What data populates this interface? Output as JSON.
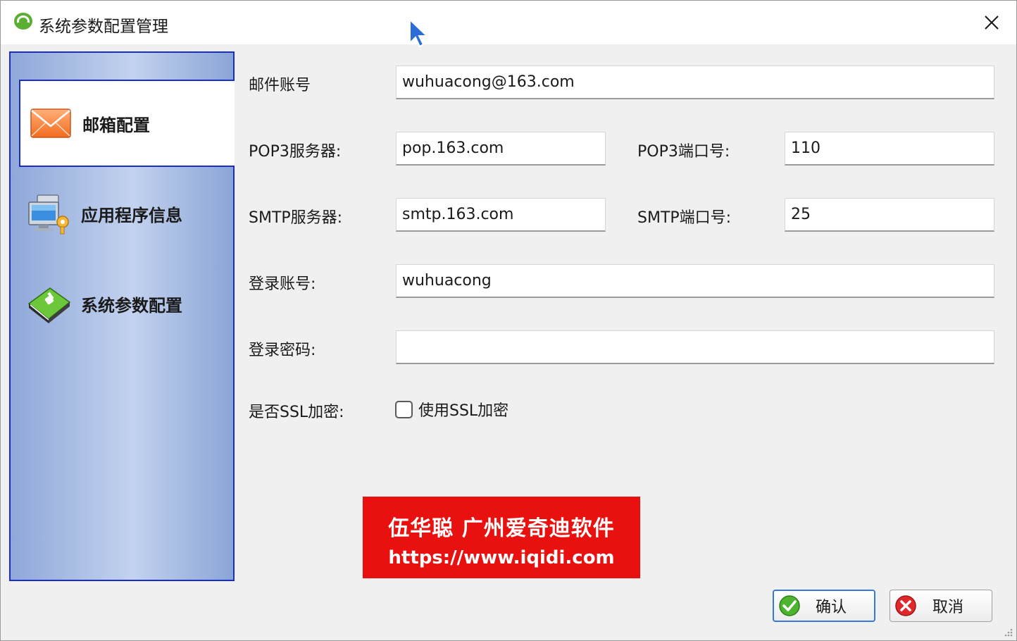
{
  "window": {
    "title": "系统参数配置管理"
  },
  "sidebar": {
    "items": [
      {
        "label": "邮箱配置",
        "icon": "mail-envelope-icon",
        "active": true
      },
      {
        "label": "应用程序信息",
        "icon": "computer-key-icon",
        "active": false
      },
      {
        "label": "系统参数配置",
        "icon": "green-book-icon",
        "active": false
      }
    ]
  },
  "form": {
    "email_account": {
      "label": "邮件账号",
      "value": "wuhuacong@163.com"
    },
    "pop3_server": {
      "label": "POP3服务器:",
      "value": "pop.163.com"
    },
    "pop3_port": {
      "label": "POP3端口号:",
      "value": "110"
    },
    "smtp_server": {
      "label": "SMTP服务器:",
      "value": "smtp.163.com"
    },
    "smtp_port": {
      "label": "SMTP端口号:",
      "value": "25"
    },
    "login_account": {
      "label": "登录账号:",
      "value": "wuhuacong"
    },
    "login_password": {
      "label": "登录密码:",
      "value": ""
    },
    "ssl": {
      "label": "是否SSL加密:",
      "checkbox_label": "使用SSL加密",
      "checked": false
    }
  },
  "watermark": {
    "line1": "伍华聪 广州爱奇迪软件",
    "line2": "https://www.iqidi.com"
  },
  "buttons": {
    "ok_label": "确认",
    "cancel_label": "取消"
  },
  "colors": {
    "sidebar_border": "#1a2ec7",
    "watermark_bg": "#e8110f",
    "ok_icon": "#4cb42e",
    "cancel_icon": "#e0282c"
  }
}
